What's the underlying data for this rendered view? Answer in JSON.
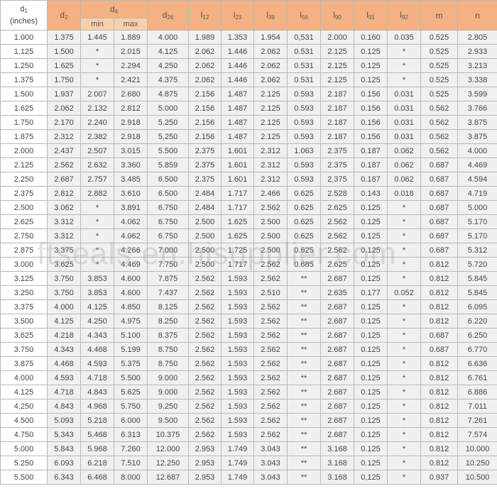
{
  "headers": {
    "d1": {
      "main": "d",
      "sub": "1",
      "unit": "(inches)"
    },
    "d2": {
      "main": "d",
      "sub": "2"
    },
    "d4": {
      "main": "d",
      "sub": "4",
      "min": "min",
      "max": "max"
    },
    "d26": {
      "main": "d",
      "sub": "26"
    },
    "l12": {
      "main": "l",
      "sub": "12"
    },
    "l23": {
      "main": "l",
      "sub": "23"
    },
    "l39": {
      "main": "l",
      "sub": "39"
    },
    "l56": {
      "main": "l",
      "sub": "56"
    },
    "l90": {
      "main": "l",
      "sub": "90"
    },
    "l91": {
      "main": "l",
      "sub": "91"
    },
    "l92": {
      "main": "l",
      "sub": "92"
    },
    "m": {
      "main": "m"
    },
    "n": {
      "main": "n"
    }
  },
  "rows": [
    [
      "1.000",
      "1.375",
      "1.445",
      "1.889",
      "4.000",
      "1.989",
      "1.353",
      "1.954",
      "0,531",
      "2.000",
      "0.160",
      "0.035",
      "0.525",
      "2.805"
    ],
    [
      "1.125",
      "1.500",
      "*",
      "2.015",
      "4.125",
      "2.062",
      "1.446",
      "2.062",
      "0.531",
      "2.125",
      "0.125",
      "*",
      "0.525",
      "2.933"
    ],
    [
      "1.250",
      "1.625",
      "*",
      "2.294",
      "4.250",
      "2.062",
      "1.446",
      "2.062",
      "0.531",
      "2.125",
      "0.125",
      "*",
      "0.525",
      "3.213"
    ],
    [
      "1.375",
      "1.750",
      "*",
      "2.421",
      "4.375",
      "2.062",
      "1.446",
      "2.062",
      "0.531",
      "2.125",
      "0.125",
      "*",
      "0.525",
      "3.338"
    ],
    [
      "1.500",
      "1.937",
      "2.007",
      "2.680",
      "4.875",
      "2.156",
      "1.487",
      "2.125",
      "0.593",
      "2.187",
      "0.156",
      "0.031",
      "0.525",
      "3.599"
    ],
    [
      "1.625",
      "2.062",
      "2.132",
      "2.812",
      "5.000",
      "2.156",
      "1.487",
      "2.125",
      "0.593",
      "2.187",
      "0.156",
      "0.031",
      "0.562",
      "3.766"
    ],
    [
      "1.750",
      "2.170",
      "2.240",
      "2.918",
      "5.250",
      "2.156",
      "1.487",
      "2.125",
      "0.593",
      "2.187",
      "0.156",
      "0.031",
      "0.562",
      "3.875"
    ],
    [
      "1.875",
      "2.312",
      "2.382",
      "2.918",
      "5.250",
      "2.156",
      "1.487",
      "2.125",
      "0.593",
      "2.187",
      "0.156",
      "0.031",
      "0.562",
      "3.875"
    ],
    [
      "2.000",
      "2.437",
      "2.507",
      "3.015",
      "5.500",
      "2.375",
      "1.601",
      "2.312",
      "1.063",
      "2.375",
      "0.187",
      "0.062",
      "0.562",
      "4.000"
    ],
    [
      "2.125",
      "2.562",
      "2.632",
      "3.360",
      "5.859",
      "2.375",
      "1.601",
      "2.312",
      "0.593",
      "2.375",
      "0.187",
      "0.062",
      "0.687",
      "4.469"
    ],
    [
      "2.250",
      "2.687",
      "2.757",
      "3.485",
      "6.500",
      "2.375",
      "1.601",
      "2.312",
      "0.593",
      "2.375",
      "0.187",
      "0.062",
      "0.687",
      "4.594"
    ],
    [
      "2.375",
      "2.812",
      "2.882",
      "3.610",
      "6.500",
      "2.484",
      "1.717",
      "2.466",
      "0.625",
      "2.528",
      "0.143",
      "0.018",
      "0.687",
      "4.719"
    ],
    [
      "2.500",
      "3.062",
      "*",
      "3.891",
      "6.750",
      "2.484",
      "1.717",
      "2.562",
      "0.625",
      "2.625",
      "0.125",
      "*",
      "0.687",
      "5.000"
    ],
    [
      "2.625",
      "3.312",
      "*",
      "4.062",
      "6.750",
      "2.500",
      "1.625",
      "2.500",
      "0.625",
      "2.562",
      "0.125",
      "*",
      "0.687",
      "5.170"
    ],
    [
      "2.750",
      "3.312",
      "*",
      "4.062",
      "6.750",
      "2.500",
      "1.625",
      "2.500",
      "0.625",
      "2.562",
      "0.125",
      "*",
      "0.687",
      "5.170"
    ],
    [
      "2.875",
      "3.375",
      "*",
      "4.266",
      "7.000",
      "2.500",
      "1.725",
      "2.500",
      "0.625",
      "2.562",
      "0.125",
      "*",
      "0.687",
      "5.312"
    ],
    [
      "3.000",
      "3.625",
      "*",
      "4.469",
      "7.750",
      "2.500",
      "1.717",
      "2.562",
      "0.685",
      "2.625",
      "0.125",
      "*",
      "0.812",
      "5.720"
    ],
    [
      "3.125",
      "3.750",
      "3.853",
      "4.600",
      "7.875",
      "2.562",
      "1.593",
      "2.562",
      "**",
      "2.687",
      "0.125",
      "*",
      "0.812",
      "5.845"
    ],
    [
      "3.250",
      "3.750",
      "3.853",
      "4.600",
      "7.437",
      "2.562",
      "1.593",
      "2.510",
      "**",
      "2.635",
      "0.177",
      "0.052",
      "0.812",
      "5.845"
    ],
    [
      "3.375",
      "4.000",
      "4.125",
      "4.850",
      "8.125",
      "2.562",
      "1.593",
      "2.562",
      "**",
      "2.687",
      "0.125",
      "*",
      "0.812",
      "6.095"
    ],
    [
      "3.500",
      "4.125",
      "4.250",
      "4.975",
      "8.250",
      "2.562",
      "1.593",
      "2.562",
      "**",
      "2.687",
      "0.125",
      "*",
      "0.812",
      "6.220"
    ],
    [
      "3.625",
      "4.218",
      "4.343",
      "5.100",
      "8.375",
      "2.562",
      "1.593",
      "2.562",
      "**",
      "2.687",
      "0.125",
      "*",
      "0.687",
      "6.250"
    ],
    [
      "3.750",
      "4.343",
      "4.468",
      "5.199",
      "8.750",
      "2.562",
      "1.593",
      "2.562",
      "**",
      "2.687",
      "0.125",
      "*",
      "0.687",
      "6.770"
    ],
    [
      "3.875",
      "4.468",
      "4.593",
      "5.375",
      "8.750",
      "2.562",
      "1.593",
      "2.562",
      "**",
      "2.687",
      "0.125",
      "*",
      "0.812",
      "6.636"
    ],
    [
      "4.000",
      "4.593",
      "4.718",
      "5.500",
      "9.000",
      "2.562",
      "1.593",
      "2.562",
      "**",
      "2.687",
      "0.125",
      "*",
      "0.812",
      "6.761"
    ],
    [
      "4.125",
      "4.718",
      "4.843",
      "5.625",
      "9.000",
      "2.562",
      "1.593",
      "2.562",
      "**",
      "2.687",
      "0.125",
      "*",
      "0.812",
      "6.886"
    ],
    [
      "4.250",
      "4.843",
      "4.968",
      "5.750",
      "9.250",
      "2.562",
      "1.593",
      "2.562",
      "**",
      "2.687",
      "0.125",
      "*",
      "0.812",
      "7.011"
    ],
    [
      "4.500",
      "5.093",
      "5.218",
      "6.000",
      "9.500",
      "2.562",
      "1.593",
      "2.562",
      "**",
      "2.687",
      "0.125",
      "*",
      "0.812",
      "7.261"
    ],
    [
      "4.750",
      "5.343",
      "5.468",
      "6.313",
      "10.375",
      "2.562",
      "1.593",
      "2.562",
      "**",
      "2.687",
      "0.125",
      "*",
      "0.812",
      "7.574"
    ],
    [
      "5.000",
      "5.843",
      "5.968",
      "7.260",
      "12.000",
      "2.953",
      "1.749",
      "3.043",
      "**",
      "3.168",
      "0.125",
      "*",
      "0.812",
      "10.000"
    ],
    [
      "5.250",
      "6.093",
      "6.218",
      "7.510",
      "12.250",
      "2.953",
      "1.749",
      "3.043",
      "**",
      "3.168",
      "0.125",
      "*",
      "0.812",
      "10.250"
    ],
    [
      "5.500",
      "6.343",
      "6.468",
      "8.000",
      "12.687",
      "2.953",
      "1.749",
      "3.043",
      "**",
      "3.168",
      "0,125",
      "*",
      "0.937",
      "10.500"
    ]
  ],
  "watermark": "ftseals.en.hisupplier.com",
  "colors": {
    "header_orange": "#f4b183",
    "header_sub": "#f8cfac",
    "cell_gray": "#f0f0f0",
    "border": "#b8b8b8"
  }
}
